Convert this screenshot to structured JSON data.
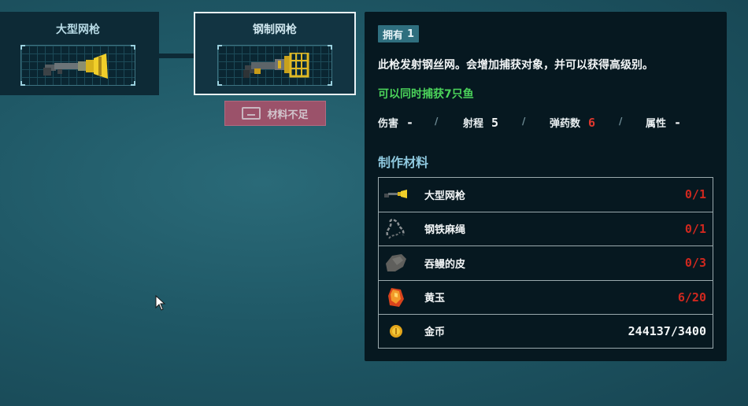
{
  "tree": {
    "large_net_gun": {
      "title": "大型网枪",
      "icon": "large-net-gun-icon"
    },
    "steel_net_gun": {
      "title": "钢制网枪",
      "icon": "steel-net-gun-icon"
    }
  },
  "craft_button": {
    "label": "材料不足",
    "icon": "keyboard-key-icon"
  },
  "details": {
    "owned_label": "拥有",
    "owned_count": "1",
    "description": "此枪发射钢丝网。会增加捕获对象，并可以获得高级别。",
    "catch_text": "可以同时捕获7只鱼",
    "stats": [
      {
        "label": "伤害",
        "value": "-"
      },
      {
        "label": "射程",
        "value": "5"
      },
      {
        "label": "弹药数",
        "value": "6"
      },
      {
        "label": "属性",
        "value": "-"
      }
    ],
    "separator": "/",
    "materials_title": "制作材料",
    "materials": [
      {
        "icon": "large-net-gun-icon",
        "name": "大型网枪",
        "count": "0/1"
      },
      {
        "icon": "steel-rope-icon",
        "name": "钢铁麻绳",
        "count": "0/1"
      },
      {
        "icon": "eel-skin-icon",
        "name": "吞鳗的皮",
        "count": "0/3"
      },
      {
        "icon": "topaz-icon",
        "name": "黄玉",
        "count": "6/20"
      },
      {
        "icon": "gold-coin-icon",
        "name": "金币",
        "count": "244137/3400"
      }
    ]
  },
  "colors": {
    "insufficient": "#d0281f",
    "catch_green": "#4bd35a",
    "stat_highlight": "#e0382f",
    "craft_button_bg": "#b0506a",
    "selected_border": "#e8f2f6"
  }
}
